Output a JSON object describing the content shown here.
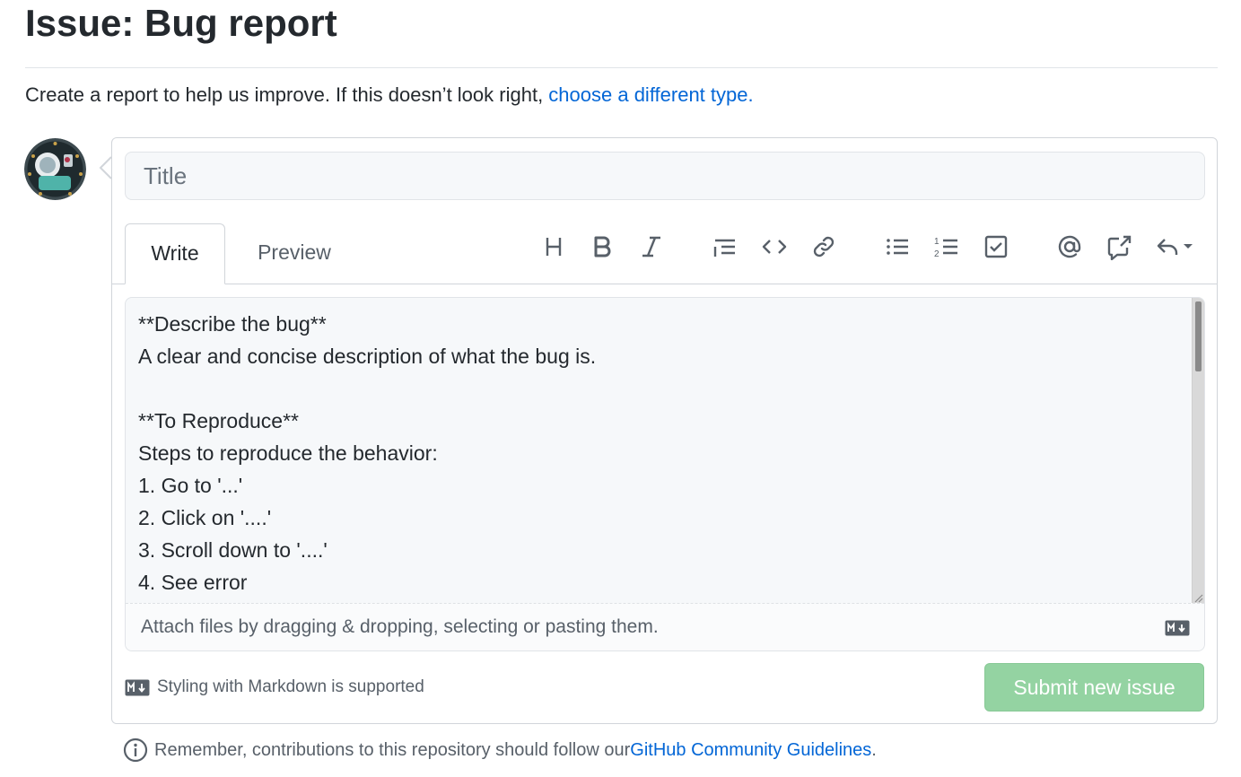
{
  "page": {
    "title": "Issue: Bug report",
    "intro_text": "Create a report to help us improve. If this doesn’t look right, ",
    "intro_link": "choose a different type."
  },
  "form": {
    "title_placeholder": "Title",
    "tabs": [
      {
        "label": "Write",
        "active": true
      },
      {
        "label": "Preview",
        "active": false
      }
    ],
    "toolbar": [
      {
        "name": "header",
        "icon": "heading-icon"
      },
      {
        "name": "bold",
        "icon": "bold-icon"
      },
      {
        "name": "italic",
        "icon": "italic-icon"
      },
      {
        "name": "quote",
        "icon": "quote-icon"
      },
      {
        "name": "code",
        "icon": "code-icon"
      },
      {
        "name": "link",
        "icon": "link-icon"
      },
      {
        "name": "unordered-list",
        "icon": "bullet-list-icon"
      },
      {
        "name": "ordered-list",
        "icon": "numbered-list-icon"
      },
      {
        "name": "task-list",
        "icon": "task-list-icon"
      },
      {
        "name": "mention",
        "icon": "mention-icon"
      },
      {
        "name": "cross-reference",
        "icon": "cross-reference-icon"
      },
      {
        "name": "saved-replies",
        "icon": "reply-icon"
      }
    ],
    "body_text": "**Describe the bug**\nA clear and concise description of what the bug is.\n\n**To Reproduce**\nSteps to reproduce the behavior:\n1. Go to '...'\n2. Click on '....'\n3. Scroll down to '....'\n4. See error",
    "attach_hint": "Attach files by dragging & dropping, selecting or pasting them.",
    "markdown_note": "Styling with Markdown is supported",
    "submit_label": "Submit new issue"
  },
  "footer": {
    "text": "Remember, contributions to this repository should follow our ",
    "link": "GitHub Community Guidelines",
    "suffix": "."
  },
  "colors": {
    "link": "#0366d6",
    "submit_disabled": "#94d3a2",
    "text": "#24292e",
    "muted": "#586069"
  }
}
